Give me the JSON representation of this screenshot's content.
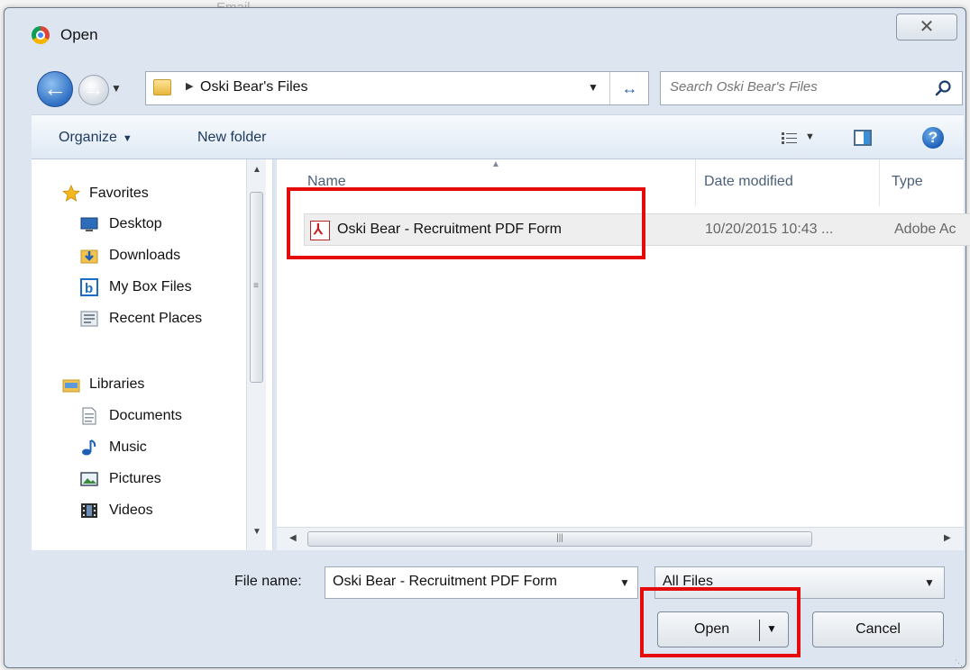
{
  "window": {
    "title": "Open",
    "close_glyph": "✕"
  },
  "address_bar": {
    "location": "Oski Bear's Files"
  },
  "search": {
    "placeholder": "Search Oski Bear's Files"
  },
  "toolbar": {
    "organize_label": "Organize",
    "new_folder_label": "New folder"
  },
  "nav": {
    "favorites": [
      {
        "label": "Favorites",
        "icon": "star-icon"
      },
      {
        "label": "Desktop",
        "icon": "desktop-icon"
      },
      {
        "label": "Downloads",
        "icon": "downloads-icon"
      },
      {
        "label": "My Box Files",
        "icon": "box-icon"
      },
      {
        "label": "Recent Places",
        "icon": "recent-places-icon"
      }
    ],
    "libraries": [
      {
        "label": "Libraries",
        "icon": "libraries-icon"
      },
      {
        "label": "Documents",
        "icon": "documents-icon"
      },
      {
        "label": "Music",
        "icon": "music-icon"
      },
      {
        "label": "Pictures",
        "icon": "pictures-icon"
      },
      {
        "label": "Videos",
        "icon": "videos-icon"
      }
    ]
  },
  "file_list": {
    "columns": [
      "Name",
      "Date modified",
      "Type"
    ],
    "rows": [
      {
        "name": "Oski Bear - Recruitment PDF Form",
        "date_modified": "10/20/2015 10:43 ...",
        "type": "Adobe Ac",
        "icon": "pdf-icon"
      }
    ]
  },
  "bottom": {
    "file_name_label": "File name:",
    "file_name_value": "Oski Bear - Recruitment PDF Form",
    "file_type_value": "All Files",
    "open_label": "Open",
    "cancel_label": "Cancel"
  },
  "colors": {
    "highlight": "#e50b0b",
    "toolbar_text": "#1e395b"
  }
}
